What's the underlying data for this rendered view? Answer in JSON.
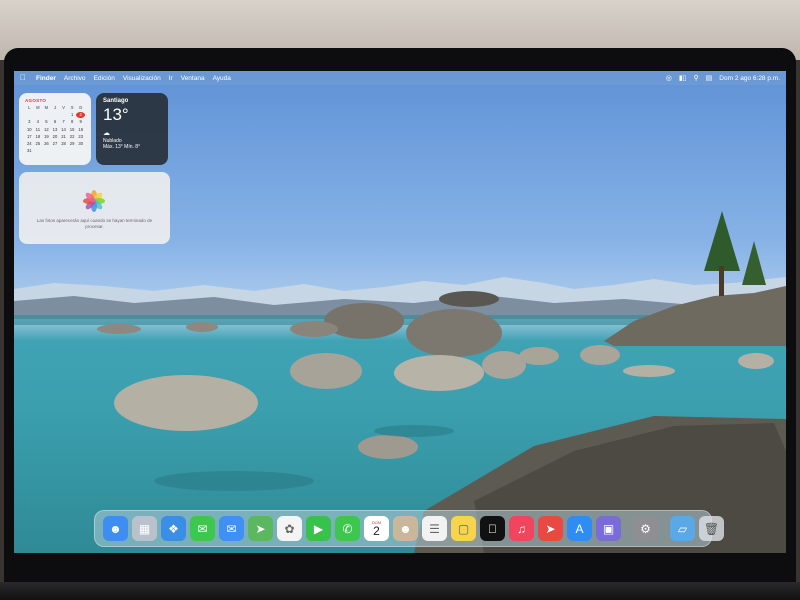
{
  "menubar": {
    "app_name": "Finder",
    "menus": [
      "Archivo",
      "Edición",
      "Visualización",
      "Ir",
      "Ventana",
      "Ayuda"
    ],
    "datetime": "Dom 2 ago 6:28 p.m."
  },
  "calendar_widget": {
    "month": "AGOSTO",
    "weekdays": [
      "L",
      "M",
      "M",
      "J",
      "V",
      "S",
      "D"
    ],
    "days": [
      "",
      "",
      "",
      "",
      "",
      "1",
      "2",
      "3",
      "4",
      "5",
      "6",
      "7",
      "8",
      "9",
      "10",
      "11",
      "12",
      "13",
      "14",
      "15",
      "16",
      "17",
      "18",
      "19",
      "20",
      "21",
      "22",
      "23",
      "24",
      "25",
      "26",
      "27",
      "28",
      "29",
      "30",
      "31"
    ],
    "today": "2"
  },
  "weather_widget": {
    "city": "Santiago",
    "temperature": "13°",
    "condition": "Nublado",
    "range": "Máx. 13° Mín. 8°"
  },
  "photos_widget": {
    "message": "Las fotos aparecerán aquí cuando se hayan terminado de procesar."
  },
  "dock": {
    "apps": [
      {
        "name": "Finder",
        "color": "#3d8ef0"
      },
      {
        "name": "Launchpad",
        "color": "#b9c1cc"
      },
      {
        "name": "Safari",
        "color": "#3a8ee6"
      },
      {
        "name": "Mensajes",
        "color": "#3ec74f"
      },
      {
        "name": "Mail",
        "color": "#3f8ff5"
      },
      {
        "name": "Mapas",
        "color": "#5bb860"
      },
      {
        "name": "Fotos",
        "color": "#f4f4f4"
      },
      {
        "name": "FaceTime",
        "color": "#38c24b"
      },
      {
        "name": "Teléfono",
        "color": "#3ec74f"
      },
      {
        "name": "Calendario",
        "color": "#ffffff"
      },
      {
        "name": "Contactos",
        "color": "#c9b79c"
      },
      {
        "name": "Recordatorios",
        "color": "#f2f2f2"
      },
      {
        "name": "Notas",
        "color": "#f6d44b"
      },
      {
        "name": "TV",
        "color": "#111111"
      },
      {
        "name": "Música",
        "color": "#f0455d"
      },
      {
        "name": "Cohete",
        "color": "#e84a43"
      },
      {
        "name": "App Store",
        "color": "#2f8cf3"
      },
      {
        "name": "Simulador",
        "color": "#7a6cd8"
      },
      {
        "name": "Configuración",
        "color": "#8e8e93"
      }
    ],
    "calendar_icon": {
      "weekday": "DOM",
      "day": "2"
    }
  }
}
